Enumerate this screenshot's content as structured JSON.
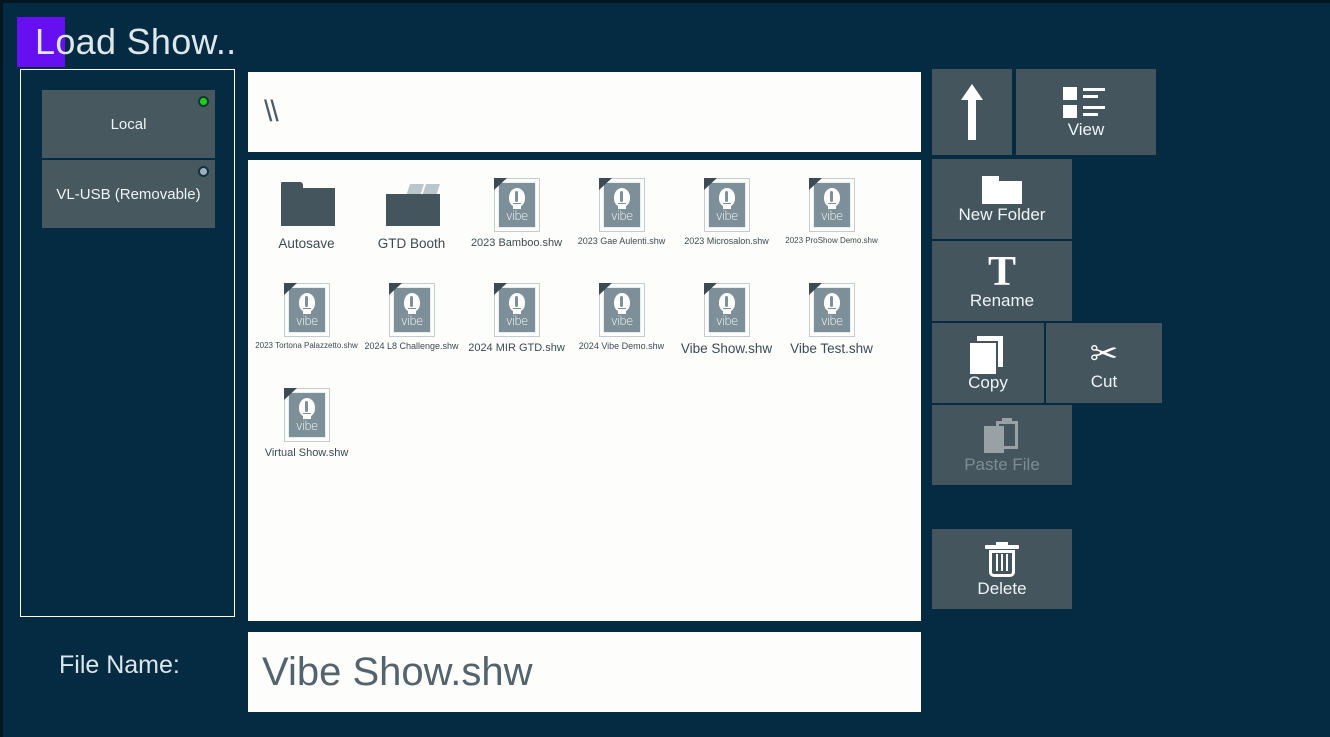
{
  "window": {
    "title": "Load Show..",
    "accent_color": "#6610f2",
    "background_color": "#042b41",
    "button_color": "#44555d"
  },
  "sidebar": {
    "drives": [
      {
        "label": "Local",
        "status": "active",
        "led_color": "#22cc22"
      },
      {
        "label": "VL-USB (Removable)",
        "status": "inactive",
        "led_color": "#9fb0b7"
      }
    ]
  },
  "path_bar": {
    "value": "\\\\"
  },
  "file_list": {
    "items": [
      {
        "name": "Autosave",
        "type": "folder",
        "size": "lg"
      },
      {
        "name": "GTD Booth",
        "type": "folder-full",
        "size": "lg"
      },
      {
        "name": "2023 Bamboo.shw",
        "type": "shw",
        "size": "md"
      },
      {
        "name": "2023 Gae Aulenti.shw",
        "type": "shw",
        "size": "sm"
      },
      {
        "name": "2023 Microsalon.shw",
        "type": "shw",
        "size": "sm"
      },
      {
        "name": "2023 ProShow Demo.shw",
        "type": "shw",
        "size": "xs"
      },
      {
        "name": "2023 Tortona Palazzetto.shw",
        "type": "shw",
        "size": "xs"
      },
      {
        "name": "2024 L8 Challenge.shw",
        "type": "shw",
        "size": "sm"
      },
      {
        "name": "2024 MIR GTD.shw",
        "type": "shw",
        "size": "md"
      },
      {
        "name": "2024 Vibe Demo.shw",
        "type": "shw",
        "size": "sm"
      },
      {
        "name": "Vibe Show.shw",
        "type": "shw",
        "size": "lg"
      },
      {
        "name": "Vibe Test.shw",
        "type": "shw",
        "size": "lg"
      },
      {
        "name": "Virtual Show.shw",
        "type": "shw",
        "size": "md"
      }
    ],
    "icon_wordmark": "vibe"
  },
  "filename_row": {
    "label": "File Name:",
    "value": "Vibe Show.shw"
  },
  "toolbar": {
    "up_label": "",
    "up_icon": "up-arrow-icon",
    "view_label": "View",
    "view_icon": "list-view-icon",
    "new_folder_label": "New Folder",
    "new_folder_icon": "folder-icon",
    "rename_label": "Rename",
    "rename_icon": "text-t-icon",
    "copy_label": "Copy",
    "copy_icon": "copy-pages-icon",
    "cut_label": "Cut",
    "cut_icon": "scissors-icon",
    "cut_glyph": "✂",
    "paste_label": "Paste File",
    "paste_icon": "clipboard-paste-icon",
    "paste_enabled": false,
    "delete_label": "Delete",
    "delete_icon": "trash-icon"
  }
}
